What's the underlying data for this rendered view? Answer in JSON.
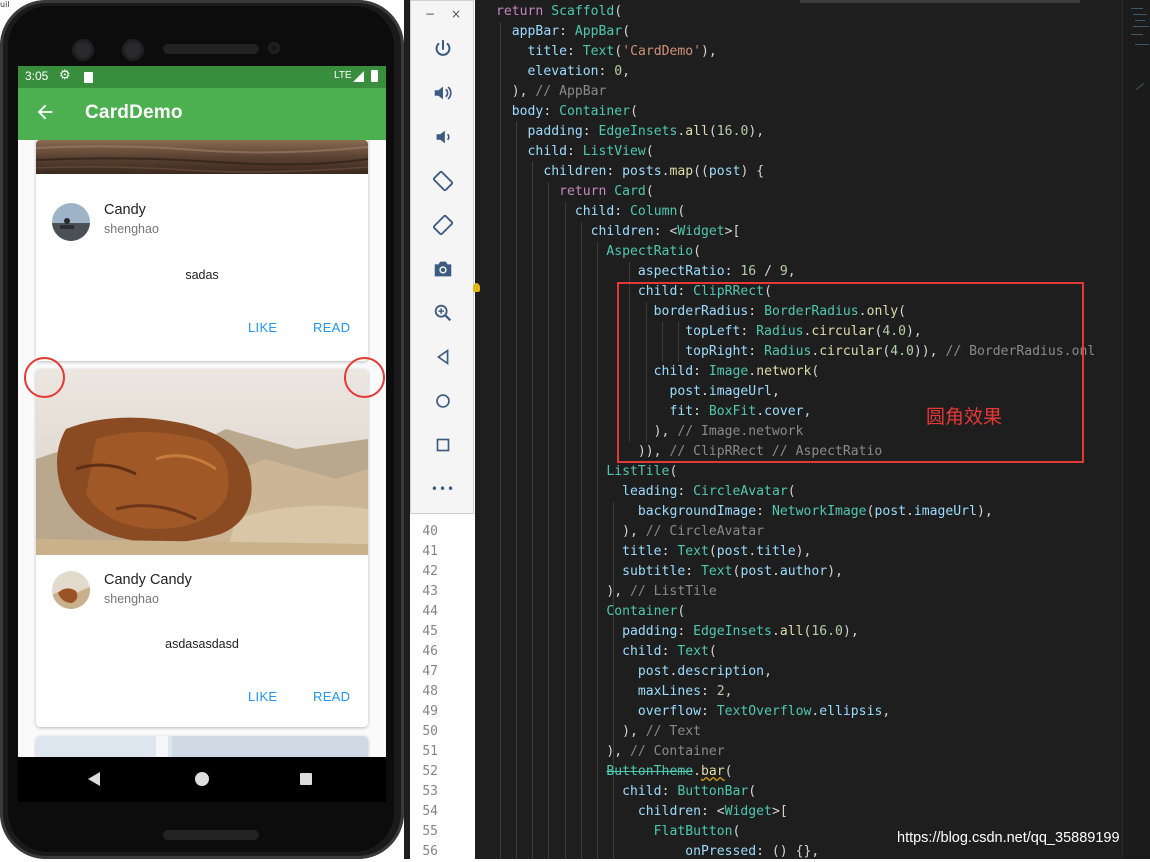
{
  "phone": {
    "status": {
      "time": "3:05",
      "network": "LTE"
    },
    "app_bar": {
      "title": "CardDemo"
    },
    "cards": [
      {
        "title": "Candy",
        "author": "shenghao",
        "description": "sadas",
        "like_label": "LIKE",
        "read_label": "READ"
      },
      {
        "title": "Candy Candy",
        "author": "shenghao",
        "description": "asdasasdasd",
        "like_label": "LIKE",
        "read_label": "READ"
      }
    ]
  },
  "emulator_toolbar": {
    "minimize": "−",
    "close": "×",
    "buttons": [
      "power-icon",
      "volume-up-icon",
      "volume-down-icon",
      "rotate-left-icon",
      "rotate-right-icon",
      "camera-icon",
      "zoom-icon",
      "back-icon",
      "home-icon",
      "overview-icon",
      "more-icon"
    ],
    "more_label": "•••"
  },
  "editor": {
    "line_numbers": [
      "40",
      "41",
      "42",
      "43",
      "44",
      "45",
      "46",
      "47",
      "48",
      "49",
      "50",
      "51",
      "52",
      "53",
      "54",
      "55",
      "56"
    ],
    "annotation": "圆角效果",
    "watermark": "https://blog.csdn.net/qq_35889199",
    "corner_text": "uil"
  },
  "colors": {
    "app_bar": "#4caf50",
    "status_bar": "#388e3c",
    "button_text": "#2196f3",
    "highlight": "#e53935",
    "editor_bg": "#1e1e1e"
  }
}
